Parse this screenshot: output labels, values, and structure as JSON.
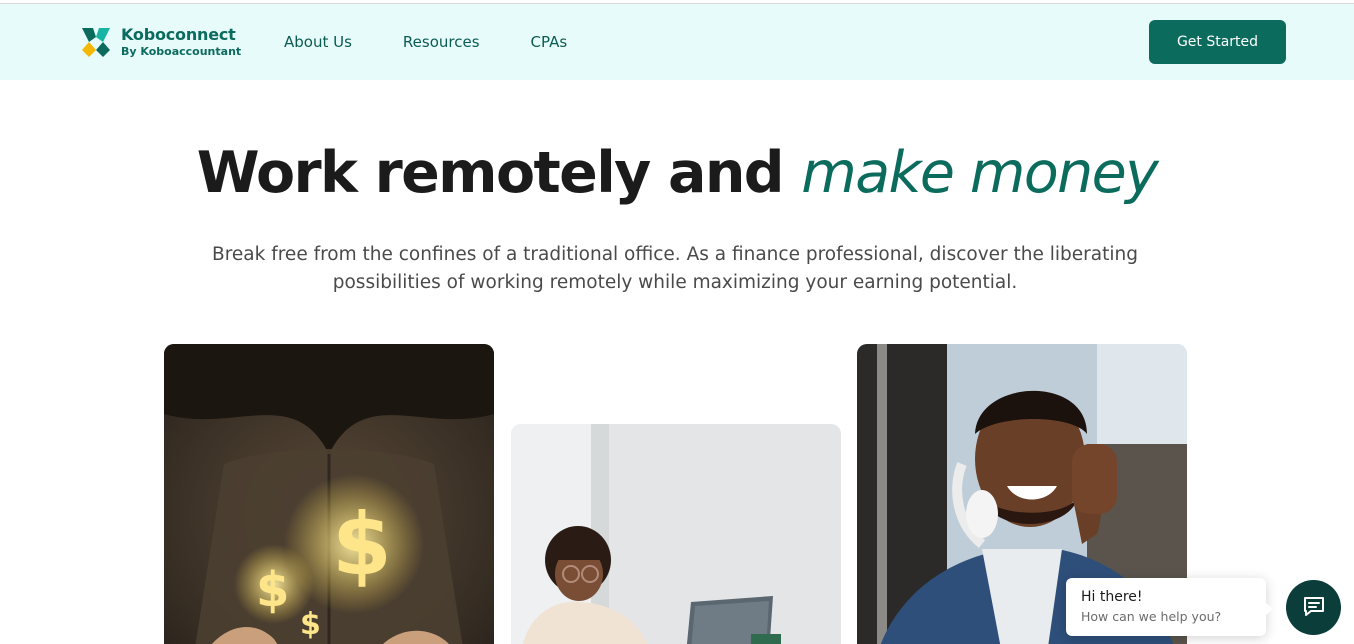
{
  "brand": {
    "name": "Koboconnect",
    "tagline": "By Koboaccountant",
    "colors": {
      "primary": "#0b6b5d",
      "nav_bg": "#e8fbfb",
      "accent_yellow": "#f5b800",
      "chat_btn": "#0b3d3a"
    },
    "logo_icon": "koboconnect-logo-icon"
  },
  "nav": {
    "links": [
      "About Us",
      "Resources",
      "CPAs"
    ],
    "cta_label": "Get Started"
  },
  "hero": {
    "title_plain": "Work remotely and ",
    "title_accent": "make money",
    "subtitle": "Break free from the confines of a traditional office. As a finance professional, discover the liberating possibilities of working remotely while maximizing your earning potential."
  },
  "images": [
    {
      "name": "money-hands-photo"
    },
    {
      "name": "woman-laptop-photo"
    },
    {
      "name": "smiling-man-headphones-photo"
    }
  ],
  "chat": {
    "title": "Hi there!",
    "subtitle": "How can we help you?",
    "icon": "chat-icon"
  }
}
